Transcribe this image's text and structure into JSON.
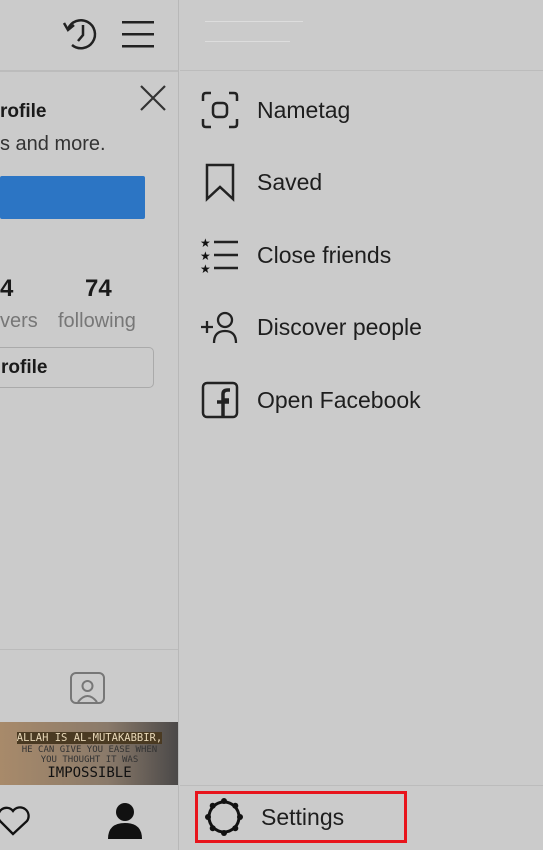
{
  "profile_card": {
    "title": "rofile",
    "subtitle": "s and more.",
    "followers_count": "4",
    "followers_label": "vers",
    "following_count": "74",
    "following_label": "following",
    "edit_button": "rofile"
  },
  "post_thumbnail": {
    "line1": "ALLAH IS AL-MUTAKABBIR,",
    "line2": "HE CAN GIVE YOU EASE WHEN",
    "line3": "YOU THOUGHT IT WAS",
    "line4": "IMPOSSIBLE"
  },
  "menu": {
    "items": [
      {
        "label": "Nametag",
        "icon": "nametag-icon"
      },
      {
        "label": "Saved",
        "icon": "bookmark-icon"
      },
      {
        "label": "Close friends",
        "icon": "close-friends-icon"
      },
      {
        "label": "Discover people",
        "icon": "add-person-icon"
      },
      {
        "label": "Open Facebook",
        "icon": "facebook-icon"
      }
    ],
    "settings": "Settings"
  },
  "colors": {
    "accent": "#2c75c4",
    "highlight": "#e8141c"
  }
}
